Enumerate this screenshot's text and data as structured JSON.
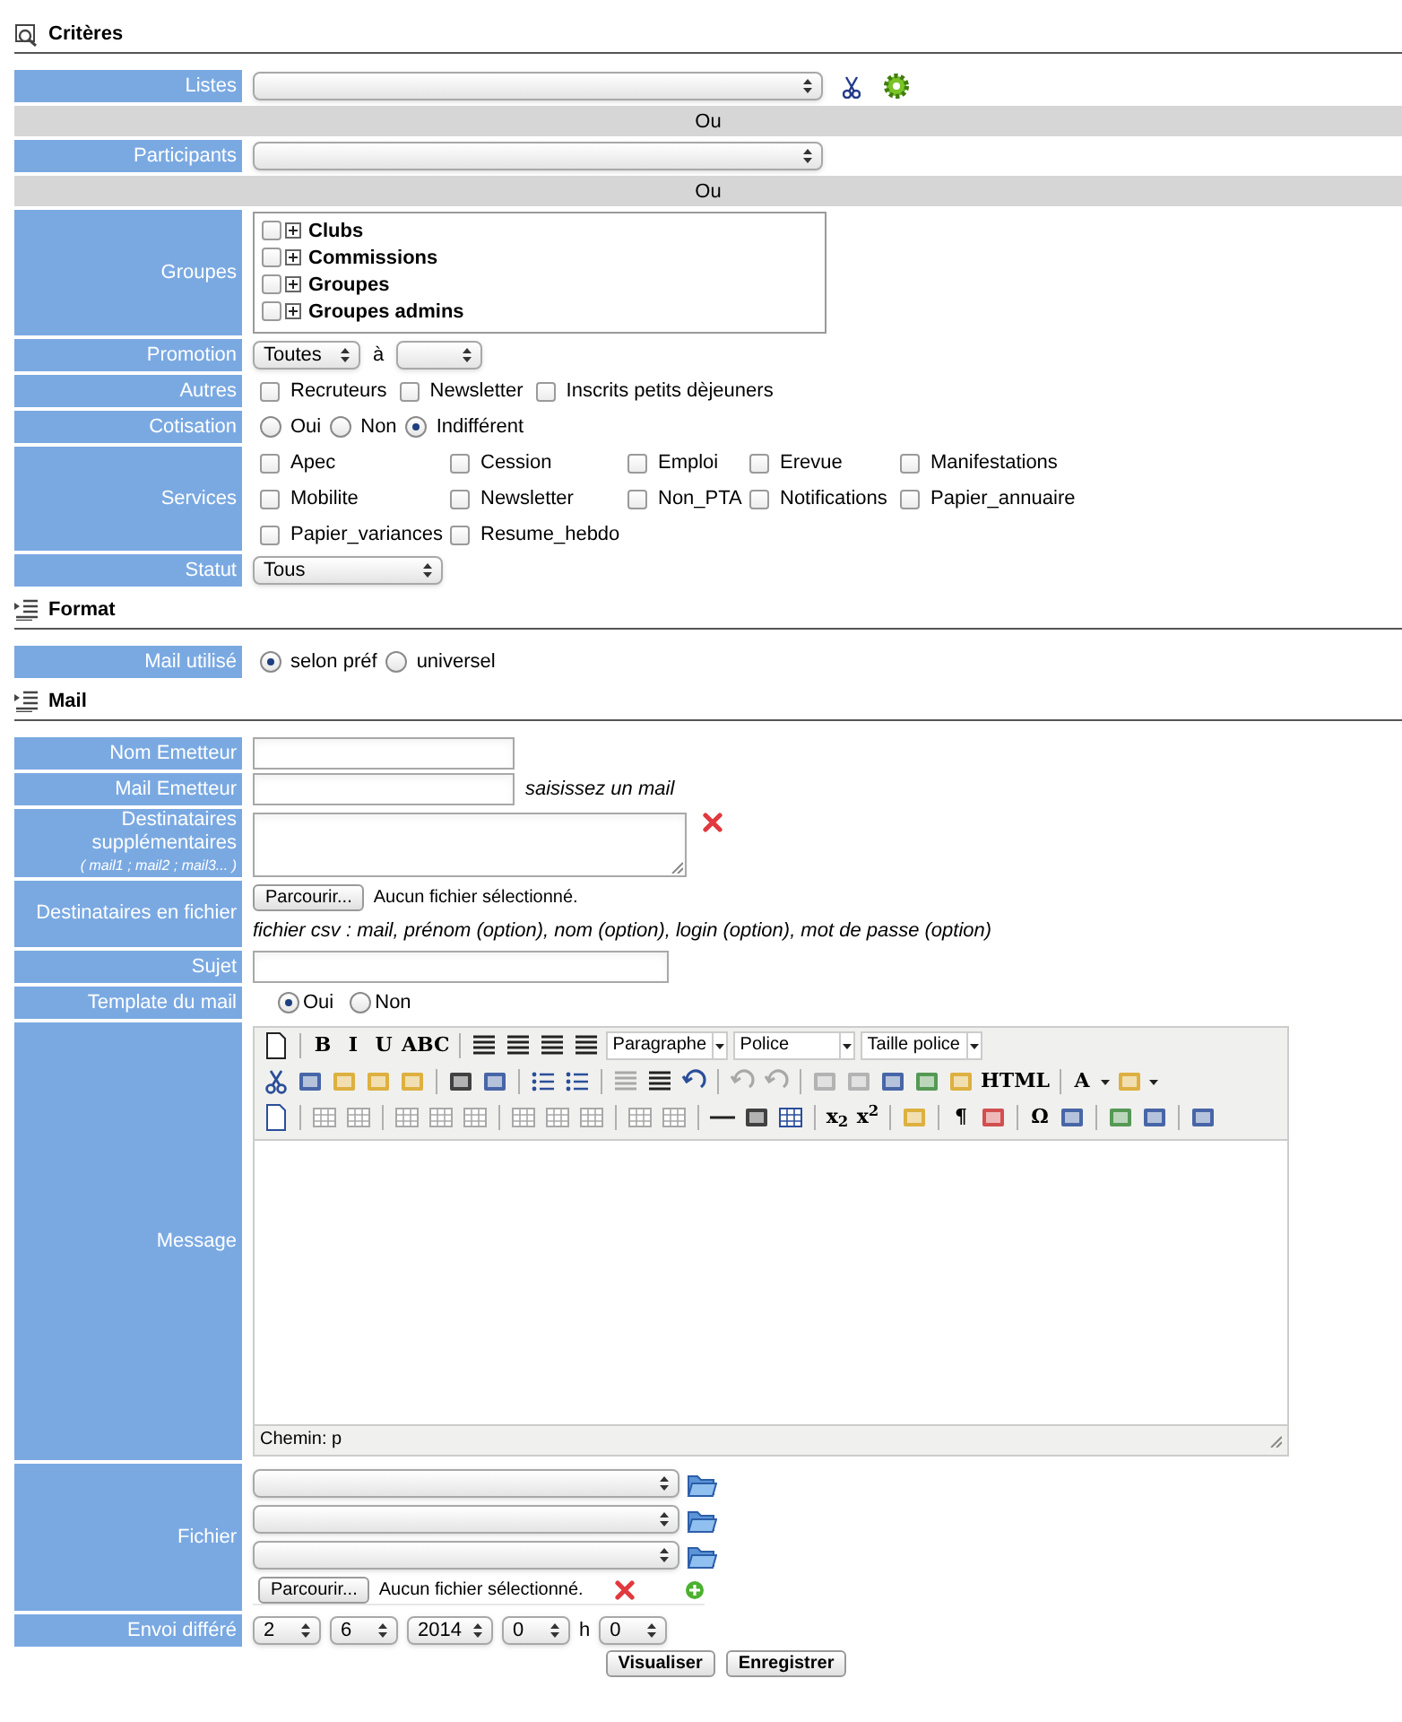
{
  "sections": [
    {
      "kind": "criteria",
      "title": "Critères",
      "rows": [
        {
          "kind": "list_select",
          "label": "Listes"
        },
        {
          "kind": "separator",
          "text": "Ou"
        },
        {
          "kind": "select",
          "label": "Participants"
        },
        {
          "kind": "separator",
          "text": "Ou"
        },
        {
          "kind": "tree",
          "label": "Groupes",
          "items": [
            {
              "text": "Clubs",
              "checked": false,
              "expanded": false
            },
            {
              "text": "Commissions",
              "checked": false,
              "expanded": false
            },
            {
              "text": "Groupes",
              "checked": false,
              "expanded": false
            },
            {
              "text": "Groupes admins",
              "checked": false,
              "expanded": false
            }
          ]
        },
        {
          "kind": "range",
          "label": "Promotion",
          "from": "Toutes",
          "joiner": "à"
        },
        {
          "kind": "checks",
          "label": "Autres",
          "options": [
            {
              "text": "Recruteurs",
              "checked": false
            },
            {
              "text": "Newsletter",
              "checked": false
            },
            {
              "text": "Inscrits petits dèjeuners",
              "checked": false
            }
          ]
        },
        {
          "kind": "radios",
          "label": "Cotisation",
          "options": [
            {
              "text": "Oui",
              "selected": false
            },
            {
              "text": "Non",
              "selected": false
            },
            {
              "text": "Indifférent",
              "selected": true
            }
          ]
        },
        {
          "kind": "grid",
          "label": "Services",
          "options": [
            {
              "text": "Apec",
              "checked": false
            },
            {
              "text": "Cession",
              "checked": false
            },
            {
              "text": "Emploi",
              "checked": false
            },
            {
              "text": "Erevue",
              "checked": false
            },
            {
              "text": "Manifestations",
              "checked": false
            },
            {
              "text": "Mobilite",
              "checked": false
            },
            {
              "text": "Newsletter",
              "checked": false
            },
            {
              "text": "Non_PTA",
              "checked": false
            },
            {
              "text": "Notifications",
              "checked": false
            },
            {
              "text": "Papier_annuaire",
              "checked": false
            },
            {
              "text": "Papier_variances",
              "checked": false
            },
            {
              "text": "Resume_hebdo",
              "checked": false
            }
          ]
        },
        {
          "kind": "short_select",
          "label": "Statut",
          "value": "Tous"
        }
      ]
    },
    {
      "kind": "format",
      "title": "Format",
      "rows": [
        {
          "kind": "radios",
          "label": "Mail utilisé",
          "options": [
            {
              "text": "selon préf",
              "selected": true
            },
            {
              "text": "universel",
              "selected": false
            }
          ]
        }
      ]
    },
    {
      "kind": "format",
      "title": "Mail",
      "rows": [
        {
          "kind": "text",
          "label": "Nom Emetteur"
        },
        {
          "kind": "text",
          "label": "Mail Emetteur",
          "note": "saisissez un mail"
        },
        {
          "kind": "textarea",
          "label": "Destinataires supplémentaires",
          "sublabel": "( mail1 ; mail2 ; mail3... )"
        },
        {
          "kind": "file",
          "label": "Destinataires en fichier",
          "button": "Parcourir...",
          "status": "Aucun fichier sélectionné.",
          "note": "fichier csv : mail, prénom (option), nom (option), login (option), mot de passe (option)"
        },
        {
          "kind": "long_text",
          "label": "Sujet"
        },
        {
          "kind": "wide_radios",
          "label": "Template du mail",
          "options": [
            {
              "text": "Oui",
              "selected": true
            },
            {
              "text": "Non",
              "selected": false
            }
          ]
        },
        {
          "kind": "editor",
          "label": "Message",
          "toolbar_texts": [
            "B",
            "I",
            "U",
            "ABC",
            "HTML",
            "A",
            "x$_{2}$",
            "x$^{2}$",
            "¶",
            "Ω"
          ],
          "toolbar_selects": [
            "Paragraphe",
            "Police",
            "Taille police"
          ],
          "path": "Chemin: p"
        },
        {
          "kind": "attachments",
          "label": "Fichier",
          "selects": [
            {
              "kind": "select"
            },
            {
              "kind": "select"
            },
            {
              "kind": "select"
            }
          ],
          "button": "Parcourir...",
          "status": "Aucun fichier sélectionné."
        },
        {
          "kind": "datetime",
          "label": "Envoi différé",
          "fields": [
            {
              "kind": "select",
              "text": "2"
            },
            {
              "kind": "select",
              "text": "6"
            },
            {
              "kind": "wide_select",
              "text": "2014"
            },
            {
              "kind": "select",
              "text": "0"
            },
            {
              "kind": "text",
              "text": "h"
            },
            {
              "kind": "select",
              "text": "0"
            }
          ]
        }
      ]
    }
  ],
  "buttons": [
    "Visualiser",
    "Enregistrer"
  ]
}
